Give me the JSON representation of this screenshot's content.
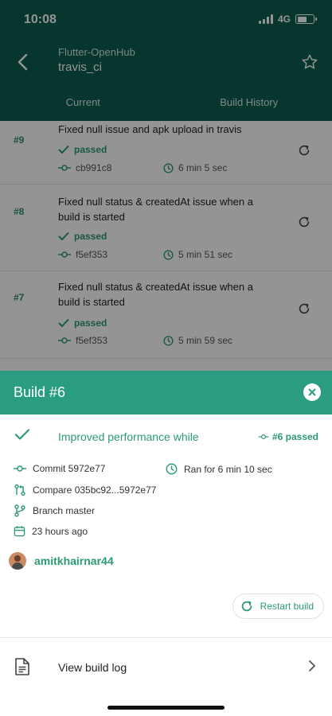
{
  "status_bar": {
    "time": "10:08",
    "network": "4G"
  },
  "app_bar": {
    "repo": "Flutter-OpenHub",
    "sub": "travis_ci"
  },
  "tabs": [
    {
      "label": "Current"
    },
    {
      "label": "Build History"
    }
  ],
  "builds": [
    {
      "num": "#9",
      "message": "Fixed null issue and apk upload in travis",
      "status": "passed",
      "commit": "cb991c8",
      "duration": "6 min 5 sec"
    },
    {
      "num": "#8",
      "message": "Fixed null status & createdAt issue when a build is started",
      "status": "passed",
      "commit": "f5ef353",
      "duration": "5 min 51 sec"
    },
    {
      "num": "#7",
      "message": "Fixed null status & createdAt issue when a build is started",
      "status": "passed",
      "commit": "f5ef353",
      "duration": "5 min 59 sec"
    }
  ],
  "sheet": {
    "title": "Build #6",
    "summary_message": "Improved performance while",
    "summary_badge": "#6 passed",
    "commit": "Commit 5972e77",
    "ran_for": "Ran for 6 min 10 sec",
    "compare": "Compare 035bc92...5972e77",
    "branch": "Branch master",
    "time_ago": "23 hours ago",
    "user": "amitkhairnar44",
    "restart_label": "Restart build",
    "view_log_label": "View build log"
  },
  "colors": {
    "primary_dark": "#0b5e4e",
    "accent": "#2a9d80",
    "success_text": "#2d9a70"
  }
}
